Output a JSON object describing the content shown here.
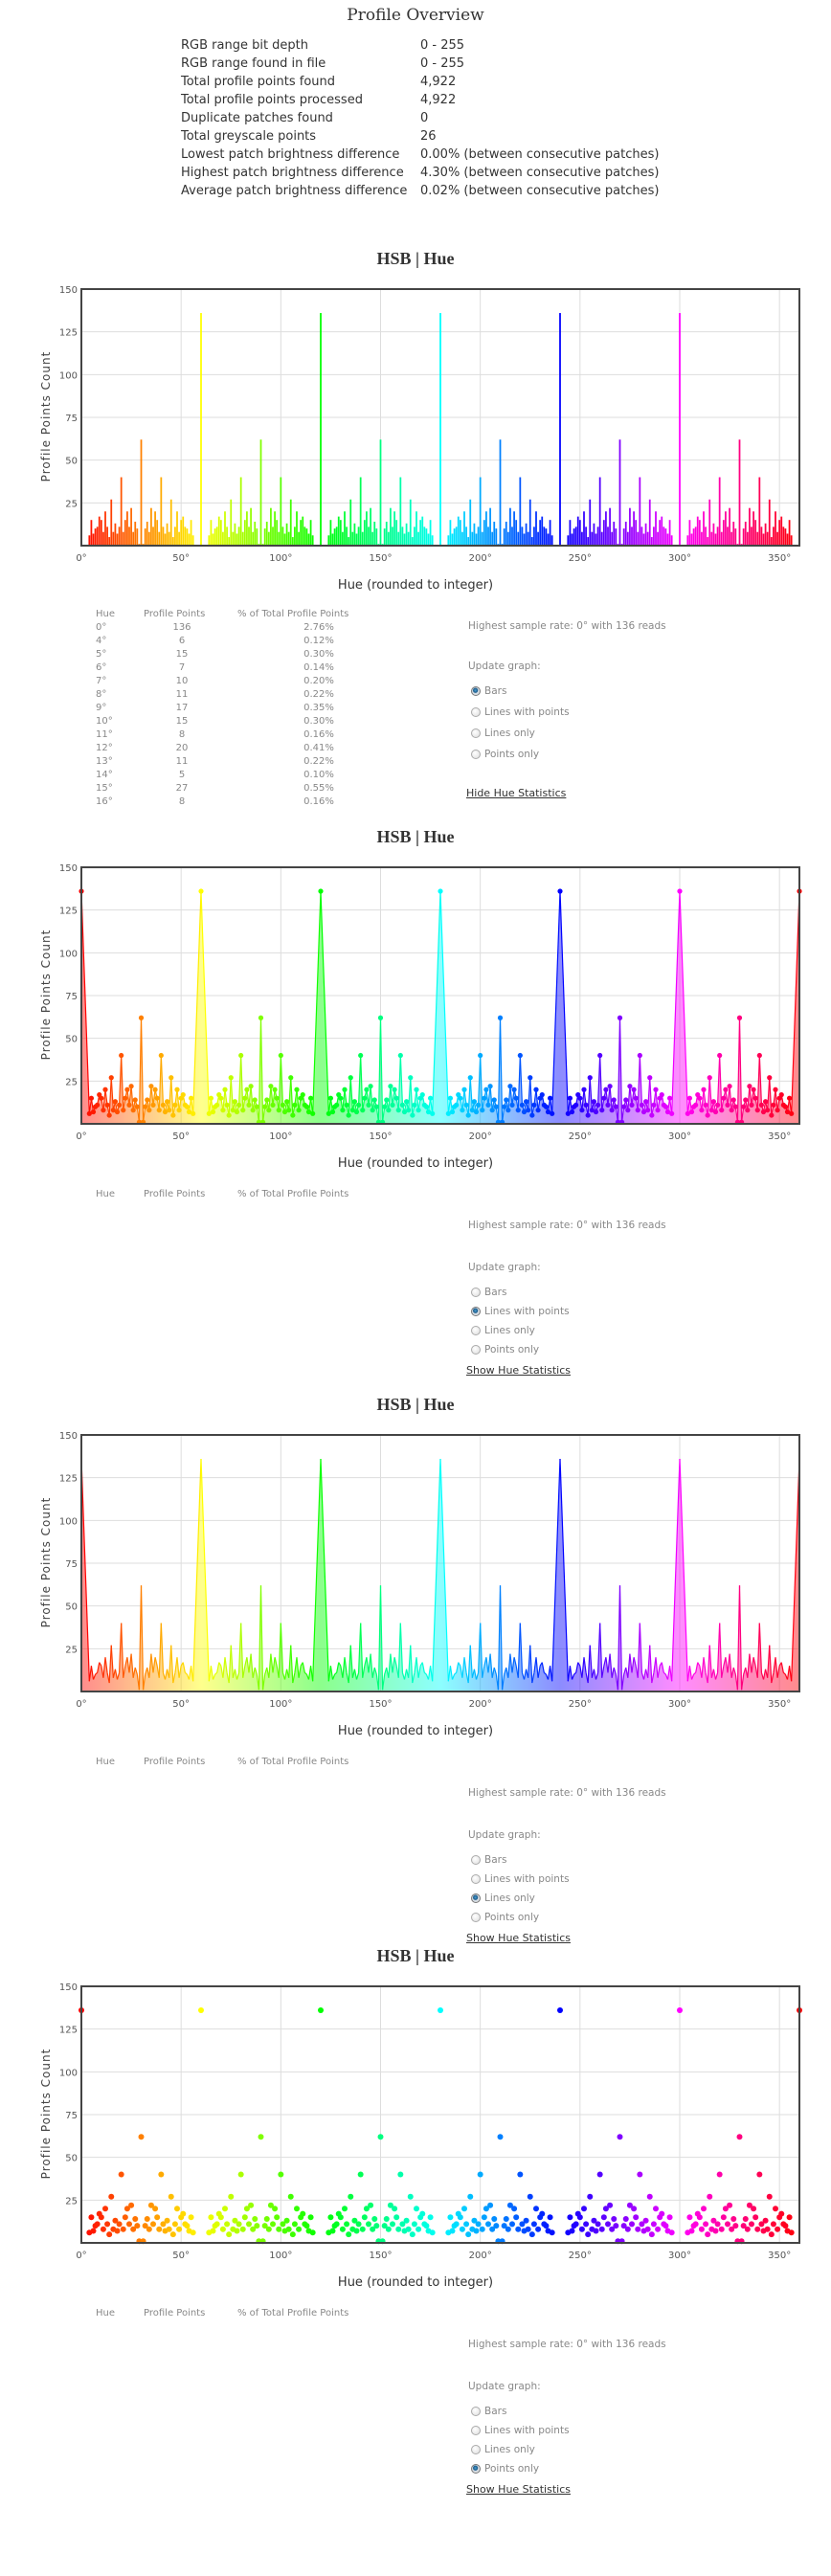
{
  "overview": {
    "title": "Profile Overview",
    "rows": [
      {
        "label": "RGB range bit depth",
        "value": "0 - 255"
      },
      {
        "label": "RGB range found in file",
        "value": "0 - 255"
      },
      {
        "label": "Total profile points found",
        "value": "4,922"
      },
      {
        "label": "Total profile points processed",
        "value": "4,922"
      },
      {
        "label": "Duplicate patches found",
        "value": "0"
      },
      {
        "label": "Total greyscale points",
        "value": "26"
      },
      {
        "label": "Lowest patch brightness difference",
        "value": "0.00% (between consecutive patches)"
      },
      {
        "label": "Highest patch brightness difference",
        "value": "4.30% (between consecutive patches)"
      },
      {
        "label": "Average patch brightness difference",
        "value": "0.02% (between consecutive patches)"
      }
    ]
  },
  "colors": {
    "border": "#444444",
    "grid": "#dddddd",
    "series_color_scheme": "hue spectrum (color of each bar = its hue)"
  },
  "chart_data": [
    {
      "type": "bar",
      "title": "HSB | Hue",
      "xlabel": "Hue (rounded to integer)",
      "ylabel": "Profile Points Count",
      "xlim": [
        0,
        360
      ],
      "ylim": [
        0,
        150
      ],
      "xticks": [
        "0°",
        "50°",
        "100°",
        "150°",
        "200°",
        "250°",
        "300°",
        "350°"
      ],
      "yticks": [
        "25",
        "50",
        "75",
        "100",
        "125",
        "150"
      ],
      "grid": true,
      "series_ref": "hue_counts"
    },
    {
      "type": "line",
      "markers": true,
      "filled": true,
      "title": "HSB | Hue",
      "xlabel": "Hue (rounded to integer)",
      "ylabel": "Profile Points Count",
      "xlim": [
        0,
        360
      ],
      "ylim": [
        0,
        150
      ],
      "xticks": [
        "0°",
        "50°",
        "100°",
        "150°",
        "200°",
        "250°",
        "300°",
        "350°"
      ],
      "yticks": [
        "25",
        "50",
        "75",
        "100",
        "125",
        "150"
      ],
      "grid": true,
      "series_ref": "hue_counts"
    },
    {
      "type": "line",
      "markers": false,
      "filled": true,
      "title": "HSB | Hue",
      "xlabel": "Hue (rounded to integer)",
      "ylabel": "Profile Points Count",
      "xlim": [
        0,
        360
      ],
      "ylim": [
        0,
        150
      ],
      "xticks": [
        "0°",
        "50°",
        "100°",
        "150°",
        "200°",
        "250°",
        "300°",
        "350°"
      ],
      "yticks": [
        "25",
        "50",
        "75",
        "100",
        "125",
        "150"
      ],
      "grid": true,
      "series_ref": "hue_counts"
    },
    {
      "type": "scatter",
      "title": "HSB | Hue",
      "xlabel": "Hue (rounded to integer)",
      "ylabel": "Profile Points Count",
      "xlim": [
        0,
        360
      ],
      "ylim": [
        0,
        150
      ],
      "xticks": [
        "0°",
        "50°",
        "100°",
        "150°",
        "200°",
        "250°",
        "300°",
        "350°"
      ],
      "yticks": [
        "25",
        "50",
        "75",
        "100",
        "125",
        "150"
      ],
      "grid": true,
      "series_ref": "hue_counts"
    }
  ],
  "hue_counts": {
    "x": [
      0,
      4,
      5,
      6,
      7,
      8,
      9,
      10,
      11,
      12,
      13,
      14,
      15,
      16,
      17,
      18,
      19,
      20,
      21,
      22,
      23,
      24,
      25,
      26,
      27,
      28,
      29,
      30,
      31,
      32,
      33,
      34,
      35,
      36,
      37,
      38,
      39,
      40,
      41,
      42,
      43,
      44,
      45,
      46,
      47,
      48,
      49,
      50,
      51,
      52,
      53,
      54,
      55,
      56,
      60,
      64,
      65,
      66,
      67,
      68,
      69,
      70,
      71,
      72,
      73,
      74,
      75,
      76,
      77,
      78,
      79,
      80,
      81,
      82,
      83,
      84,
      85,
      86,
      87,
      88,
      89,
      90,
      91,
      92,
      93,
      94,
      95,
      96,
      97,
      98,
      99,
      100,
      101,
      102,
      103,
      104,
      105,
      106,
      107,
      108,
      109,
      110,
      111,
      112,
      113,
      114,
      115,
      116,
      120,
      124,
      125,
      126,
      127,
      128,
      129,
      130,
      131,
      132,
      133,
      134,
      135,
      136,
      137,
      138,
      139,
      140,
      141,
      142,
      143,
      144,
      145,
      146,
      147,
      148,
      149,
      150,
      151,
      152,
      153,
      154,
      155,
      156,
      157,
      158,
      159,
      160,
      161,
      162,
      163,
      164,
      165,
      166,
      167,
      168,
      169,
      170,
      171,
      172,
      173,
      174,
      175,
      176,
      180,
      184,
      185,
      186,
      187,
      188,
      189,
      190,
      191,
      192,
      193,
      194,
      195,
      196,
      197,
      198,
      199,
      200,
      201,
      202,
      203,
      204,
      205,
      206,
      207,
      208,
      209,
      210,
      211,
      212,
      213,
      214,
      215,
      216,
      217,
      218,
      219,
      220,
      221,
      222,
      223,
      224,
      225,
      226,
      227,
      228,
      229,
      230,
      231,
      232,
      233,
      234,
      235,
      236,
      240,
      244,
      245,
      246,
      247,
      248,
      249,
      250,
      251,
      252,
      253,
      254,
      255,
      256,
      257,
      258,
      259,
      260,
      261,
      262,
      263,
      264,
      265,
      266,
      267,
      268,
      269,
      270,
      271,
      272,
      273,
      274,
      275,
      276,
      277,
      278,
      279,
      280,
      281,
      282,
      283,
      284,
      285,
      286,
      287,
      288,
      289,
      290,
      291,
      292,
      293,
      294,
      295,
      296,
      300,
      304,
      305,
      306,
      307,
      308,
      309,
      310,
      311,
      312,
      313,
      314,
      315,
      316,
      317,
      318,
      319,
      320,
      321,
      322,
      323,
      324,
      325,
      326,
      327,
      328,
      329,
      330,
      331,
      332,
      333,
      334,
      335,
      336,
      337,
      338,
      339,
      340,
      341,
      342,
      343,
      344,
      345,
      346,
      347,
      348,
      349,
      350,
      351,
      352,
      353,
      354,
      355,
      356,
      360
    ],
    "y": [
      136,
      6,
      15,
      7,
      10,
      11,
      17,
      15,
      8,
      20,
      11,
      5,
      27,
      8,
      13,
      7,
      11,
      40,
      8,
      15,
      20,
      11,
      22,
      8,
      14,
      10,
      1,
      62,
      1,
      10,
      14,
      8,
      22,
      11,
      20,
      15,
      8,
      40,
      11,
      7,
      13,
      8,
      27,
      5,
      11,
      20,
      8,
      15,
      17,
      11,
      10,
      7,
      15,
      6,
      136,
      6,
      15,
      7,
      10,
      11,
      17,
      15,
      8,
      20,
      11,
      5,
      27,
      8,
      13,
      7,
      11,
      40,
      8,
      15,
      20,
      11,
      22,
      8,
      14,
      10,
      1,
      62,
      1,
      10,
      14,
      8,
      22,
      11,
      20,
      15,
      8,
      40,
      11,
      7,
      13,
      8,
      27,
      5,
      11,
      20,
      8,
      15,
      17,
      11,
      10,
      7,
      15,
      6,
      136,
      6,
      15,
      7,
      10,
      11,
      17,
      15,
      8,
      20,
      11,
      5,
      27,
      8,
      13,
      7,
      11,
      40,
      8,
      15,
      20,
      11,
      22,
      8,
      14,
      10,
      1,
      62,
      1,
      10,
      14,
      8,
      22,
      11,
      20,
      15,
      8,
      40,
      11,
      7,
      13,
      8,
      27,
      5,
      11,
      20,
      8,
      15,
      17,
      11,
      10,
      7,
      15,
      6,
      136,
      6,
      15,
      7,
      10,
      11,
      17,
      15,
      8,
      20,
      11,
      5,
      27,
      8,
      13,
      7,
      11,
      40,
      8,
      15,
      20,
      11,
      22,
      8,
      14,
      10,
      1,
      62,
      1,
      10,
      14,
      8,
      22,
      11,
      20,
      15,
      8,
      40,
      11,
      7,
      13,
      8,
      27,
      5,
      11,
      20,
      8,
      15,
      17,
      11,
      10,
      7,
      15,
      6,
      136,
      6,
      15,
      7,
      10,
      11,
      17,
      15,
      8,
      20,
      11,
      5,
      27,
      8,
      13,
      7,
      11,
      40,
      8,
      15,
      20,
      11,
      22,
      8,
      14,
      10,
      1,
      62,
      1,
      10,
      14,
      8,
      22,
      11,
      20,
      15,
      8,
      40,
      11,
      7,
      13,
      8,
      27,
      5,
      11,
      20,
      8,
      15,
      17,
      11,
      10,
      7,
      15,
      6,
      136,
      6,
      15,
      7,
      10,
      11,
      17,
      15,
      8,
      20,
      11,
      5,
      27,
      8,
      13,
      7,
      11,
      40,
      8,
      15,
      20,
      11,
      22,
      8,
      14,
      10,
      1,
      62,
      1,
      10,
      14,
      8,
      22,
      11,
      20,
      15,
      8,
      40,
      11,
      7,
      13,
      8,
      27,
      5,
      11,
      20,
      8,
      15,
      17,
      11,
      10,
      7,
      15,
      6,
      136
    ]
  },
  "sections": [
    {
      "title": "HSB | Hue",
      "xlabel": "Hue (rounded to integer)",
      "ylabel": "Profile Points Count",
      "table_headers": [
        "Hue",
        "Profile Points",
        "% of Total Profile Points"
      ],
      "table_rows": [
        [
          "0°",
          "136",
          "2.76%"
        ],
        [
          "4°",
          "6",
          "0.12%"
        ],
        [
          "5°",
          "15",
          "0.30%"
        ],
        [
          "6°",
          "7",
          "0.14%"
        ],
        [
          "7°",
          "10",
          "0.20%"
        ],
        [
          "8°",
          "11",
          "0.22%"
        ],
        [
          "9°",
          "17",
          "0.35%"
        ],
        [
          "10°",
          "15",
          "0.30%"
        ],
        [
          "11°",
          "8",
          "0.16%"
        ],
        [
          "12°",
          "20",
          "0.41%"
        ],
        [
          "13°",
          "11",
          "0.22%"
        ],
        [
          "14°",
          "5",
          "0.10%"
        ],
        [
          "15°",
          "27",
          "0.55%"
        ],
        [
          "16°",
          "8",
          "0.16%"
        ]
      ],
      "highest_sample": "Highest sample rate: 0° with 136 reads",
      "update_label": "Update graph:",
      "options": [
        "Bars",
        "Lines with points",
        "Lines only",
        "Points only"
      ],
      "selected": 0,
      "stats_link": "Hide Hue Statistics"
    },
    {
      "title": "HSB | Hue",
      "xlabel": "Hue (rounded to integer)",
      "ylabel": "Profile Points Count",
      "table_headers": [
        "Hue",
        "Profile Points",
        "% of Total Profile Points"
      ],
      "table_rows": [],
      "highest_sample": "Highest sample rate: 0° with 136 reads",
      "update_label": "Update graph:",
      "options": [
        "Bars",
        "Lines with points",
        "Lines only",
        "Points only"
      ],
      "selected": 1,
      "stats_link": "Show Hue Statistics"
    },
    {
      "title": "HSB | Hue",
      "xlabel": "Hue (rounded to integer)",
      "ylabel": "Profile Points Count",
      "table_headers": [
        "Hue",
        "Profile Points",
        "% of Total Profile Points"
      ],
      "table_rows": [],
      "highest_sample": "Highest sample rate: 0° with 136 reads",
      "update_label": "Update graph:",
      "options": [
        "Bars",
        "Lines with points",
        "Lines only",
        "Points only"
      ],
      "selected": 2,
      "stats_link": "Show Hue Statistics"
    },
    {
      "title": "HSB | Hue",
      "xlabel": "Hue (rounded to integer)",
      "ylabel": "Profile Points Count",
      "table_headers": [
        "Hue",
        "Profile Points",
        "% of Total Profile Points"
      ],
      "table_rows": [],
      "highest_sample": "Highest sample rate: 0° with 136 reads",
      "update_label": "Update graph:",
      "options": [
        "Bars",
        "Lines with points",
        "Lines only",
        "Points only"
      ],
      "selected": 3,
      "stats_link": "Show Hue Statistics"
    }
  ]
}
